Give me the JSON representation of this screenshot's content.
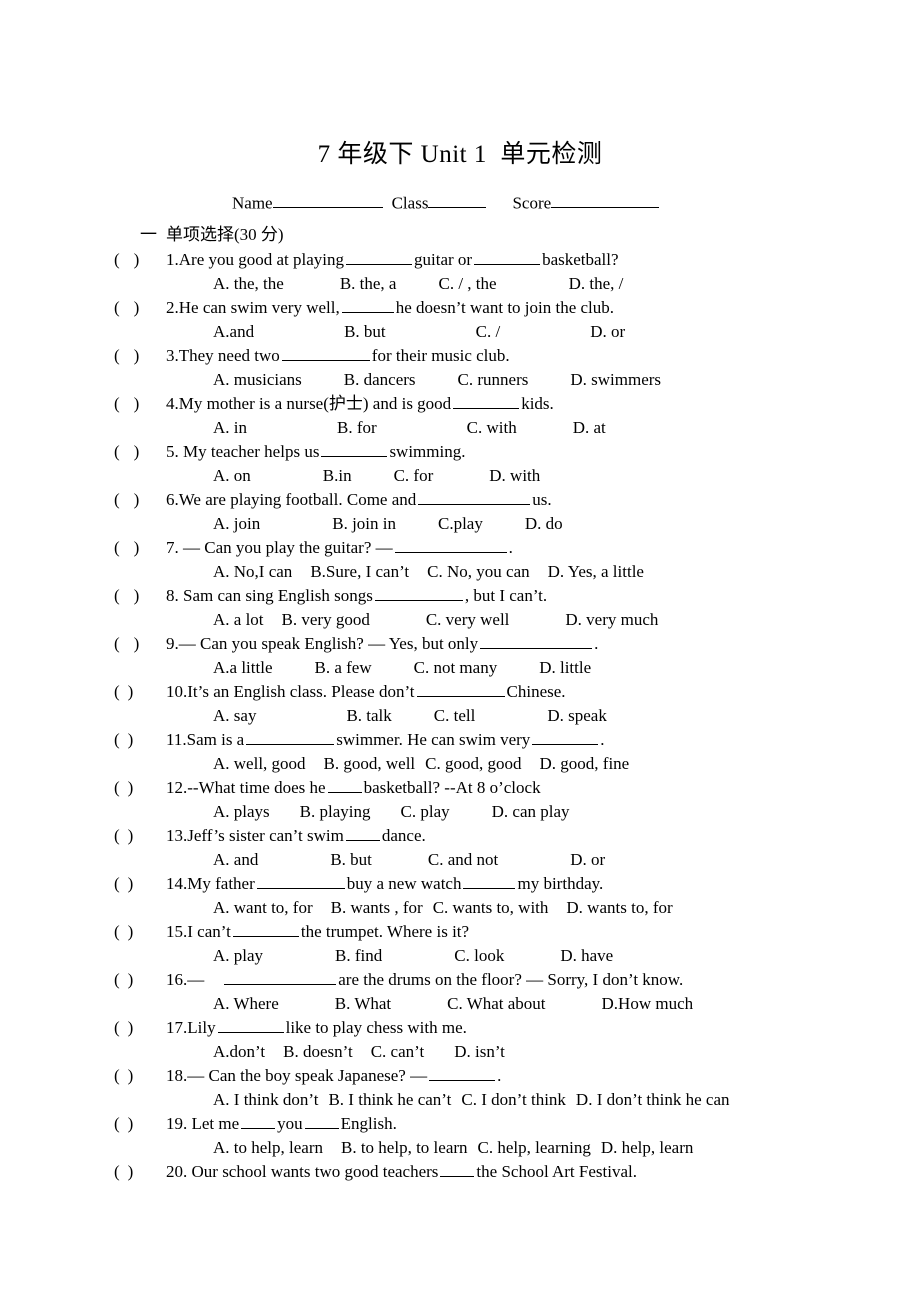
{
  "document": {
    "title": "7 年级下 Unit 1  单元检测",
    "header_fields": [
      {
        "label": "Name",
        "value": "",
        "rule": "w-name"
      },
      {
        "label": "Class",
        "value": "",
        "rule": "w-class"
      },
      {
        "label": "Score",
        "value": "",
        "rule": "w-score"
      }
    ],
    "section": {
      "number": "一",
      "title": "单项选择(30 分)"
    },
    "answer_bracket": {
      "left": "(",
      "right": ")"
    }
  },
  "questions": [
    {
      "number": "1.",
      "stem_before": "Are you good at playing",
      "stem_mid": "guitar or",
      "stem_after": "basketball?",
      "blank1": "b-md",
      "blank2": "b-md",
      "pattern": "two-blank",
      "options": [
        "A. the, the",
        "B. the, a",
        "C. / , the",
        "D. the, /"
      ],
      "opt_gaps": [
        "sp6",
        "sp5",
        "sp7"
      ]
    },
    {
      "number": "2.",
      "stem_before": "He can swim very well,",
      "stem_after": "he doesn’t want to join the club.",
      "blank1": "b-sm",
      "pattern": "one-blank",
      "options": [
        "A.and",
        "B. but",
        "C. /",
        "D. or"
      ],
      "opt_gaps": [
        "sp8",
        "sp8",
        "sp8"
      ]
    },
    {
      "number": "3.",
      "stem_before": "They need two",
      "stem_after": "for their music club.",
      "blank1": "b-lg",
      "pattern": "one-blank",
      "options": [
        "A. musicians",
        "B. dancers",
        "C. runners",
        "D. swimmers"
      ],
      "opt_gaps": [
        "sp5",
        "sp5",
        "sp5"
      ]
    },
    {
      "number": "4.",
      "stem_before": "My mother is a nurse(护士) and is good",
      "stem_after": "kids.",
      "blank1": "b-md",
      "pattern": "one-blank",
      "options": [
        "A. in",
        "B. for",
        "C. with",
        "D. at"
      ],
      "opt_gaps": [
        "sp8",
        "sp8",
        "sp6"
      ]
    },
    {
      "number": "5.",
      "stem_before": " My teacher helps us",
      "stem_after": "swimming.",
      "blank1": "b-md",
      "pattern": "one-blank",
      "options": [
        "A. on",
        "B.in",
        "C. for",
        "D. with"
      ],
      "opt_gaps": [
        "sp7",
        "sp5",
        "sp6"
      ]
    },
    {
      "number": "6.",
      "stem_before": "We are playing football. Come and",
      "stem_after": "us.",
      "blank1": "b-xl",
      "pattern": "one-blank",
      "options": [
        "A. join",
        "B. join in",
        "C.play",
        "D. do"
      ],
      "opt_gaps": [
        "sp7",
        "sp5",
        "sp5"
      ]
    },
    {
      "number": "7.",
      "stem_before": " — Can you play the guitar? —",
      "stem_after": ".",
      "blank1": "b-xl",
      "pattern": "one-blank",
      "options": [
        "A. No,I can",
        "B.Sure, I can’t",
        "C. No, you can",
        "D. Yes, a little"
      ],
      "opt_gaps": [
        "sp3",
        "sp3",
        "sp3"
      ]
    },
    {
      "number": "8.",
      "stem_before": " Sam can sing English songs",
      "stem_after": ", but I can’t.",
      "blank1": "b-lg",
      "pattern": "one-blank-nospace",
      "options": [
        "A.   a lot",
        "B. very good",
        "C. very well",
        "D. very much"
      ],
      "opt_gaps": [
        "sp3",
        "sp6",
        "sp6"
      ]
    },
    {
      "number": "9.",
      "stem_before": "— Can you speak English? — Yes, but only",
      "stem_after": ".",
      "blank1": "b-xl",
      "pattern": "one-blank-nospace",
      "options": [
        "A.a little",
        "B. a few",
        "C. not many",
        "D. little"
      ],
      "opt_gaps": [
        "sp5",
        "sp5",
        "sp5"
      ]
    },
    {
      "number": "10.",
      "stem_before": "It’s an English class. Please don’t",
      "stem_after": "Chinese.",
      "blank1": "b-lg",
      "pattern": "one-blank",
      "options": [
        "A. say",
        "B. talk",
        "C. tell",
        "D. speak"
      ],
      "opt_gaps": [
        "sp8",
        "sp5",
        "sp7"
      ]
    },
    {
      "number": "11.",
      "stem_before": "Sam is a",
      "stem_mid": "swimmer. He can swim very",
      "stem_after": ".",
      "blank1": "b-lg",
      "blank2": "b-md",
      "pattern": "two-blank-nospace",
      "options": [
        "A. well, good",
        "B. good, well",
        "C. good, good",
        "D. good, fine"
      ],
      "opt_gaps": [
        "sp3",
        "sp2",
        "sp3"
      ]
    },
    {
      "number": "12.",
      "stem_before": "--What time does he",
      "stem_after": "basketball?    --At 8 o’clock",
      "blank1": "b-xs",
      "pattern": "one-blank",
      "options": [
        "A. plays",
        "B. playing",
        "C. play",
        "D. can play"
      ],
      "opt_gaps": [
        "sp4",
        "sp4",
        "sp5"
      ]
    },
    {
      "number": "13.",
      "stem_before": "Jeff’s sister can’t swim",
      "stem_after": "dance.",
      "blank1": "b-xs",
      "pattern": "one-blank",
      "options": [
        "A. and",
        "B. but",
        "C. and not",
        "D. or"
      ],
      "opt_gaps": [
        "sp7",
        "sp6",
        "sp7"
      ]
    },
    {
      "number": "14.",
      "stem_before": "My father",
      "stem_mid": "buy a new watch",
      "stem_after": "my birthday.",
      "blank1": "b-lg",
      "blank2": "b-sm",
      "pattern": "two-blank",
      "options": [
        "A. want to, for",
        "B. wants , for",
        "C. wants to, with",
        "D. wants to, for"
      ],
      "opt_gaps": [
        "sp3",
        "sp2",
        "sp3"
      ]
    },
    {
      "number": "15.",
      "stem_before": "I can’t",
      "stem_after": "the trumpet. Where is it?",
      "blank1": "b-md",
      "pattern": "one-blank-nospace",
      "options": [
        "A. play",
        "B. find",
        "C. look",
        "D. have"
      ],
      "opt_gaps": [
        "sp7",
        "sp7",
        "sp6"
      ]
    },
    {
      "number": "16.",
      "stem_before": "—",
      "stem_after": "are the drums on the floor? — Sorry, I don’t know.",
      "blank1": "b-xl",
      "pattern": "one-blank-wide",
      "options": [
        "A. Where",
        "B. What",
        "C. What about",
        "D.How much"
      ],
      "opt_gaps": [
        "sp6",
        "sp6",
        "sp6"
      ]
    },
    {
      "number": "17.",
      "stem_before": "Lily",
      "stem_after": "like to play chess with me.",
      "blank1": "b-md",
      "pattern": "one-blank",
      "options": [
        "A.don’t",
        "B. doesn’t",
        "C. can’t",
        "D. isn’t"
      ],
      "opt_gaps": [
        "sp3",
        "sp3",
        "sp4"
      ]
    },
    {
      "number": "18.",
      "stem_before": "— Can the boy speak Japanese? —",
      "stem_after": ".",
      "blank1": "b-md",
      "pattern": "one-blank",
      "options": [
        "A. I think don’t",
        "B. I think he can’t",
        "C. I don’t think",
        "D. I don’t think he can"
      ],
      "opt_gaps": [
        "sp2",
        "sp2",
        "sp2"
      ]
    },
    {
      "number": "19.",
      "stem_before": " Let me",
      "stem_mid": "you",
      "stem_after": "English.",
      "blank1": "b-xs",
      "blank2": "b-xs",
      "pattern": "two-blank",
      "options": [
        "A. to help, learn",
        "B. to help, to learn",
        "C. help, learning",
        "D. help, learn"
      ],
      "opt_gaps": [
        "sp3",
        "sp2",
        "sp2"
      ]
    },
    {
      "number": "20.",
      "stem_before": " Our school wants two good teachers",
      "stem_after": "the School Art Festival.",
      "blank1": "b-xs",
      "pattern": "one-blank",
      "options": [],
      "opt_gaps": []
    }
  ]
}
